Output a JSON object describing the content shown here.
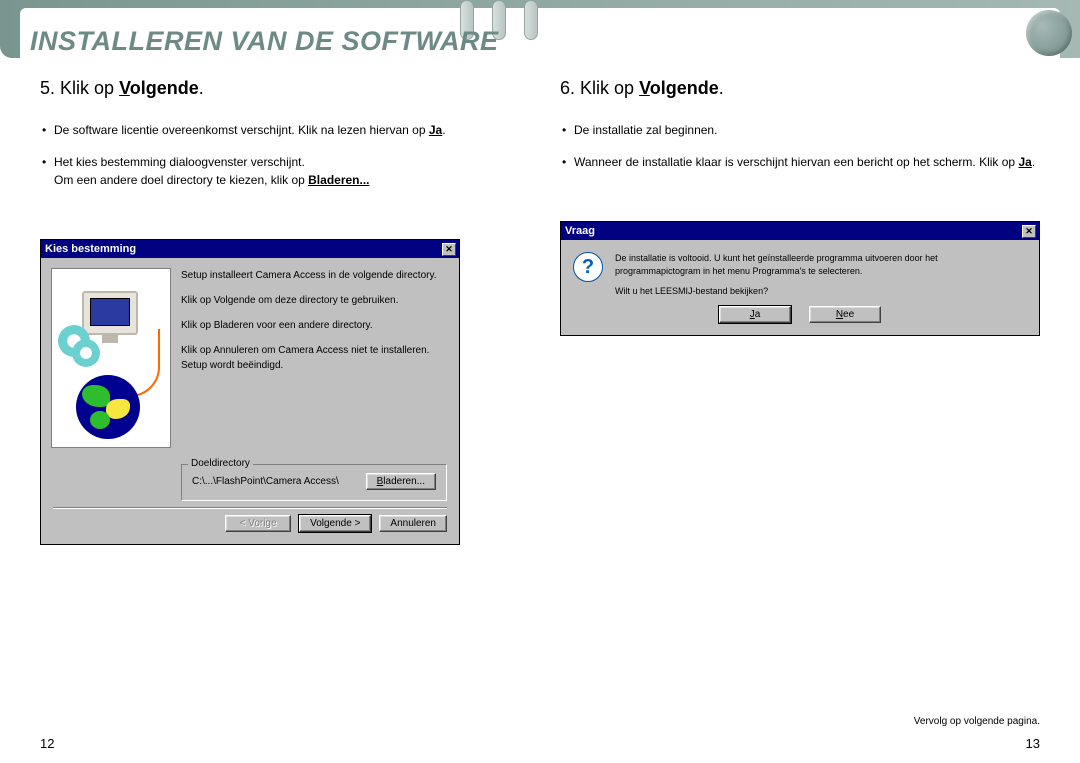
{
  "header": {
    "title": "INSTALLEREN VAN DE SOFTWARE"
  },
  "left": {
    "step_num": "5.",
    "step_prefix": "Klik op ",
    "step_v": "V",
    "step_rest": "olgende",
    "step_dot": ".",
    "bullets": [
      {
        "text_a": "De software licentie overeenkomst verschijnt. Klik na lezen hiervan op ",
        "bold_under": "Ja",
        "text_b": "."
      },
      {
        "text_a": "Het kies bestemming dialoogvenster verschijnt.",
        "text_b": "Om een andere doel directory te kiezen, klik op ",
        "bold_under": "Bladeren...",
        "text_c": ""
      }
    ],
    "dialog": {
      "title": "Kies bestemming",
      "lines": [
        "Setup installeert Camera Access in de volgende directory.",
        "Klik op Volgende om deze directory te gebruiken.",
        "Klik op Bladeren voor een andere directory.",
        "Klik op Annuleren om Camera Access niet te installeren. Setup wordt beëindigd."
      ],
      "doel_label": "Doeldirectory",
      "path": "C:\\...\\FlashPoint\\Camera Access\\",
      "browse": "Bladeren...",
      "back": "< Vorige",
      "next": "Volgende >",
      "cancel": "Annuleren"
    },
    "page_num": "12"
  },
  "right": {
    "step_num": "6.",
    "step_prefix": "Klik op ",
    "step_v": "V",
    "step_rest": "olgende",
    "step_dot": ".",
    "bullets": [
      {
        "text_a": "De installatie zal beginnen."
      },
      {
        "text_a": "Wanneer de installatie klaar is verschijnt hiervan een bericht op het scherm. Klik op ",
        "bold_under": "Ja",
        "text_b": "."
      }
    ],
    "dialog": {
      "title": "Vraag",
      "line1": "De installatie is voltooid. U kunt het geïnstalleerde programma uitvoeren door het programmapictogram in het menu Programma's te selecteren.",
      "line2": "Wilt u het LEESMIJ-bestand bekijken?",
      "yes": "Ja",
      "no": "Nee"
    },
    "continued": "Vervolg op volgende pagina.",
    "page_num": "13"
  }
}
